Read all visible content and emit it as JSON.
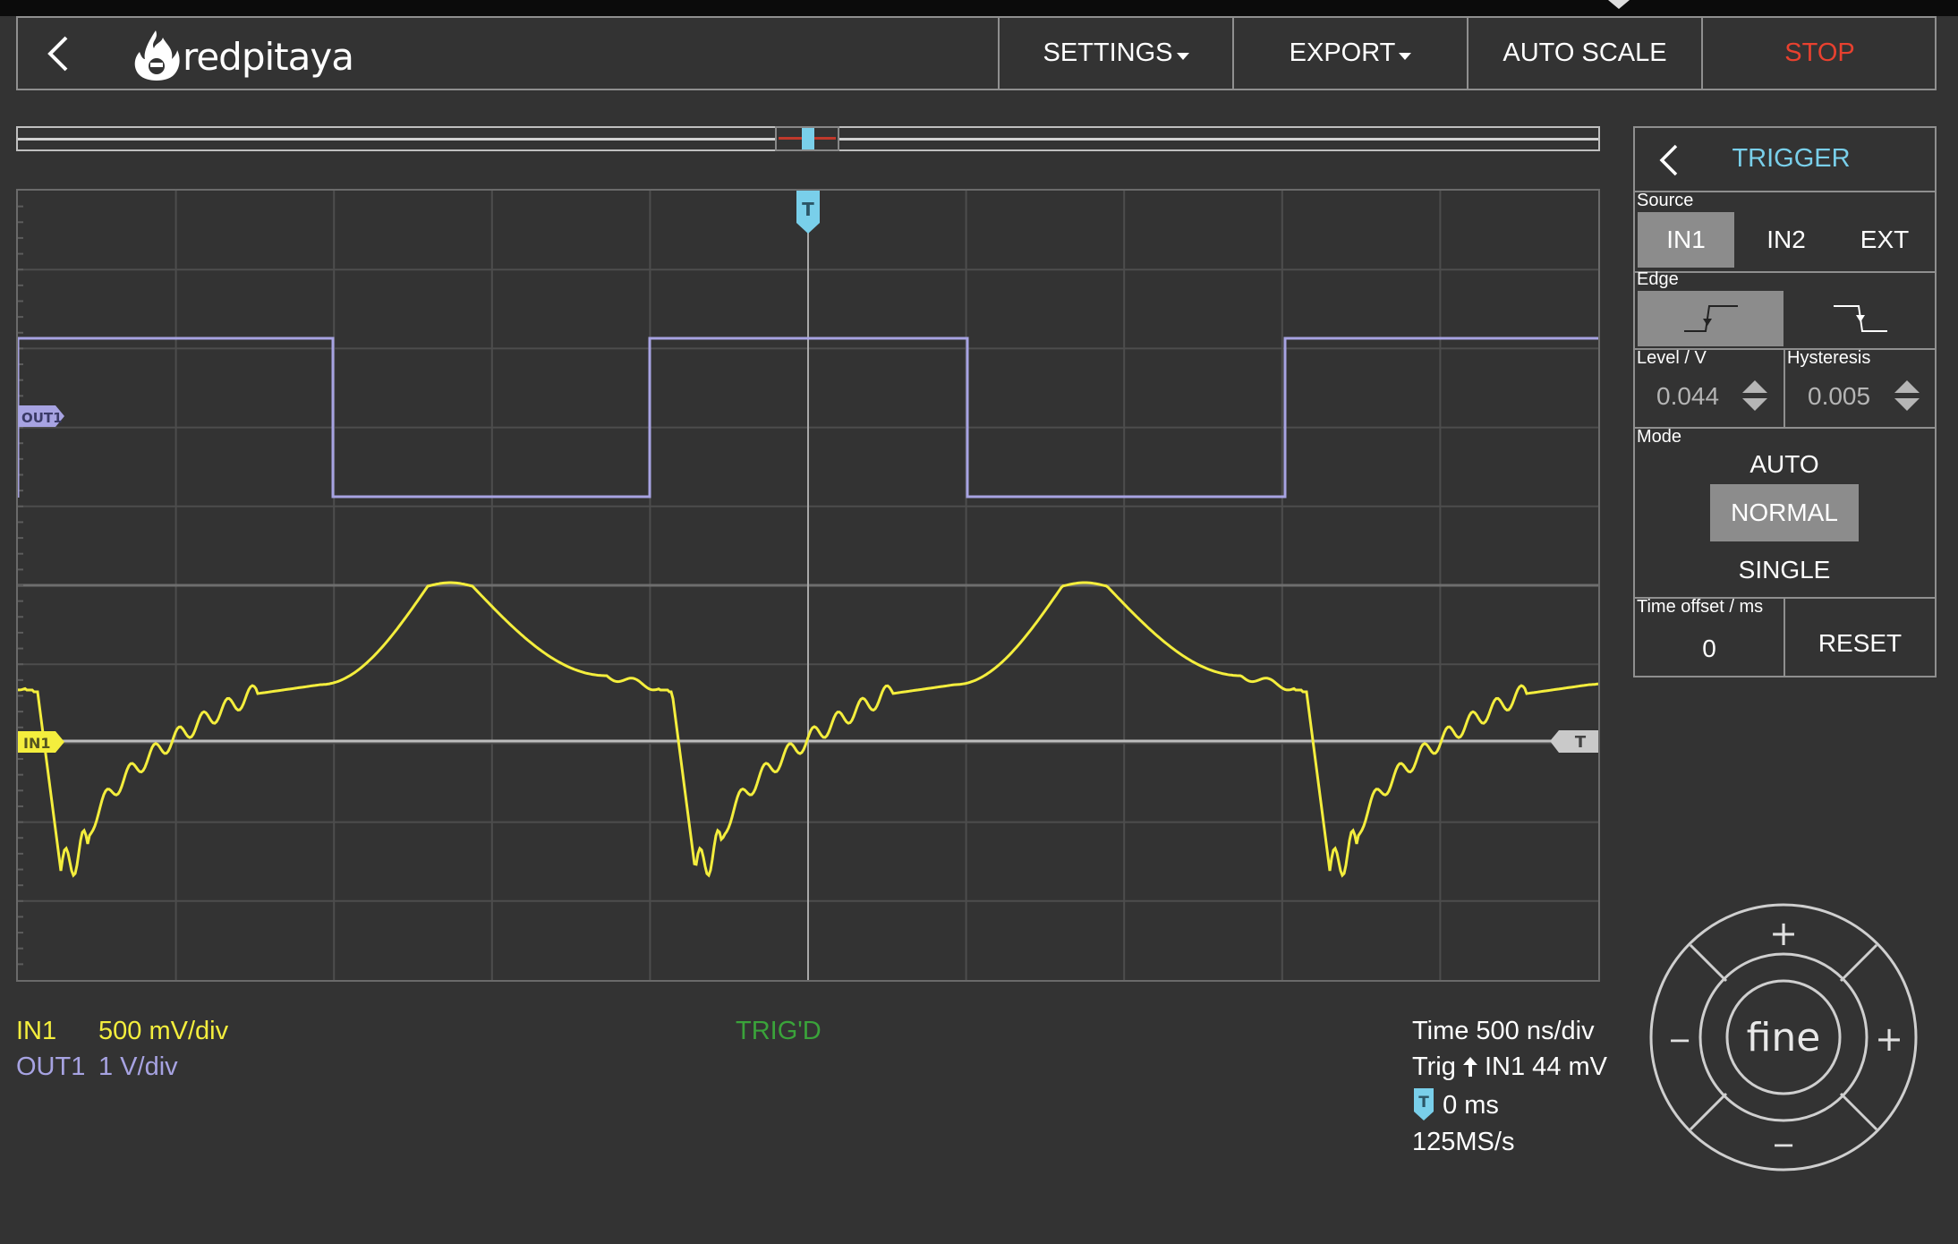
{
  "header": {
    "logo_text": "redpitaya",
    "settings_label": "SETTINGS",
    "export_label": "EXPORT",
    "autoscale_label": "AUTO SCALE",
    "stop_label": "STOP"
  },
  "plot": {
    "trigger_marker": "T",
    "out1_marker": "OUT1",
    "in1_marker": "IN1",
    "level_marker": "T"
  },
  "channels": {
    "in1_name": "IN1",
    "in1_scale": "500 mV/div",
    "out1_name": "OUT1",
    "out1_scale": "1 V/div",
    "status": "TRIG'D"
  },
  "timebase": {
    "time": "Time 500 ns/div",
    "trig_prefix": "Trig",
    "trig_rest": "IN1 44 mV",
    "offset": "0 ms",
    "offset_marker": "T",
    "rate": "125MS/s"
  },
  "trigger": {
    "title": "TRIGGER",
    "source_label": "Source",
    "sources": [
      "IN1",
      "IN2",
      "EXT"
    ],
    "source_selected": "IN1",
    "edge_label": "Edge",
    "level_label": "Level / V",
    "level_value": "0.044",
    "hysteresis_label": "Hysteresis",
    "hysteresis_value": "0.005",
    "mode_label": "Mode",
    "modes": [
      "AUTO",
      "NORMAL",
      "SINGLE"
    ],
    "mode_selected": "NORMAL",
    "time_offset_label": "Time offset / ms",
    "time_offset_value": "0",
    "reset_label": "RESET"
  },
  "wheel": {
    "center_label": "fine",
    "up_symbol": "+",
    "down_symbol": "−",
    "left_symbol": "−",
    "right_symbol": "+"
  },
  "colors": {
    "in1": "#f4ee3d",
    "out1": "#a7a3e2",
    "trigger": "#79cfea",
    "stop": "#e8412f",
    "status": "#3aa33a"
  }
}
